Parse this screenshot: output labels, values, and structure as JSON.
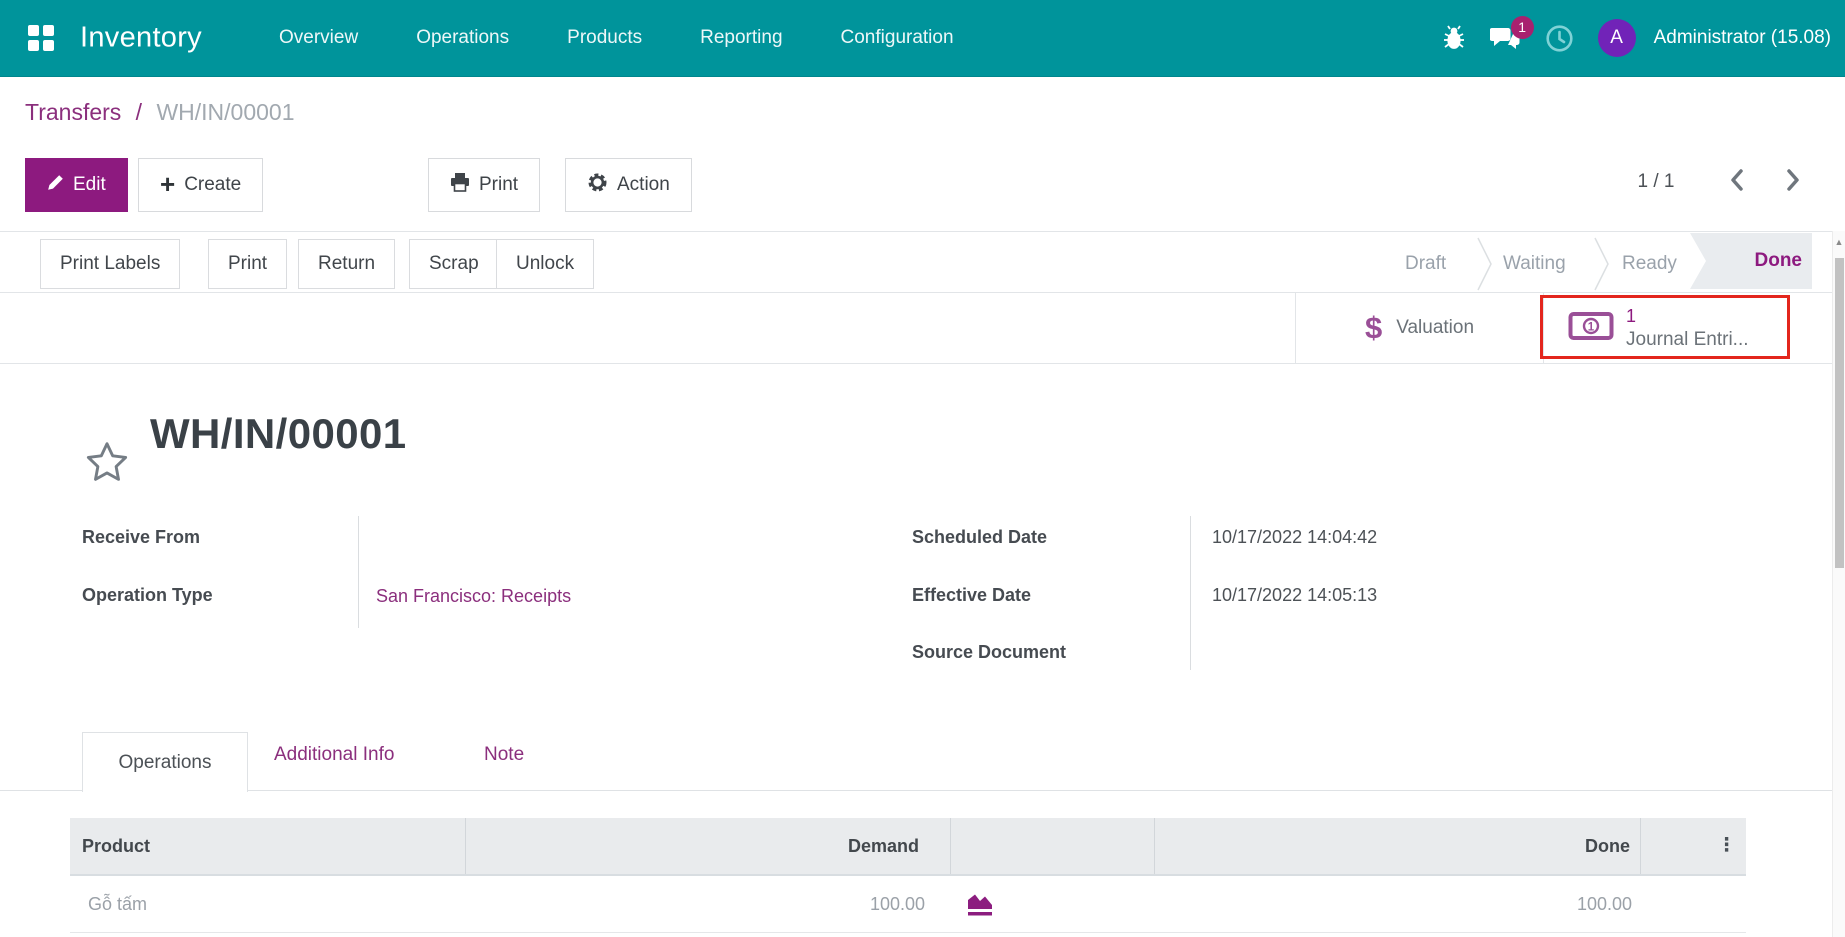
{
  "navbar": {
    "app_name": "Inventory",
    "menu_items": [
      "Overview",
      "Operations",
      "Products",
      "Reporting",
      "Configuration"
    ],
    "message_badge": "1",
    "avatar_initial": "A",
    "user_name": "Administrator (15.08)"
  },
  "breadcrumb": {
    "parent": "Transfers",
    "separator": "/",
    "current": "WH/IN/00001"
  },
  "actions": {
    "edit_label": "Edit",
    "create_label": "Create",
    "print_label": "Print",
    "action_label": "Action",
    "pager": "1 / 1"
  },
  "statusbar": {
    "buttons": [
      "Print Labels",
      "Print",
      "Return",
      "Scrap",
      "Unlock"
    ],
    "stages": [
      "Draft",
      "Waiting",
      "Ready",
      "Done"
    ],
    "active_stage": "Done"
  },
  "smart_buttons": {
    "valuation": {
      "icon_glyph": "$",
      "label": "Valuation"
    },
    "journal_entries": {
      "count": "1",
      "label": "Journal Entri...",
      "highlighted": true
    }
  },
  "record": {
    "title": "WH/IN/00001",
    "fields_left": [
      {
        "label": "Receive From",
        "value": ""
      },
      {
        "label": "Operation Type",
        "value": "San Francisco: Receipts"
      }
    ],
    "fields_right": [
      {
        "label": "Scheduled Date",
        "value": "10/17/2022 14:04:42"
      },
      {
        "label": "Effective Date",
        "value": "10/17/2022 14:05:13"
      },
      {
        "label": "Source Document",
        "value": ""
      }
    ]
  },
  "tabs": {
    "active": "Operations",
    "items": [
      "Operations",
      "Additional Info",
      "Note"
    ]
  },
  "operations_table": {
    "columns": [
      "Product",
      "Demand",
      "",
      "Done"
    ],
    "options_glyph": "⋮",
    "rows": [
      {
        "product": "Gỗ tấm",
        "demand": "100.00",
        "done": "100.00"
      }
    ]
  },
  "colors": {
    "navbar_teal": "#00949b",
    "primary_purple": "#8d1a7f",
    "link_purple": "#8b2f7d",
    "icon_purple": "#9a4f97",
    "highlight_box_red": "#e3261d",
    "avatar_violet": "#7123b8",
    "badge_magenta": "#a8216f",
    "done_stage_bg": "#e9ecef",
    "table_header_bg": "#e9ebed",
    "muted_row_text": "#9ba1a8"
  }
}
